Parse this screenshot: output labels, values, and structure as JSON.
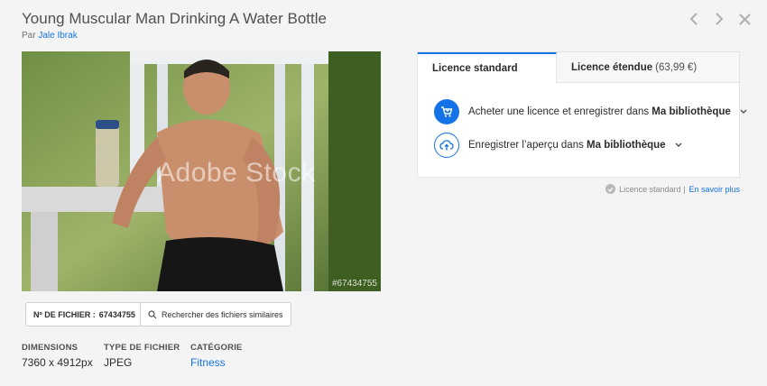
{
  "header": {
    "title": "Young Muscular Man Drinking A Water Bottle",
    "by_prefix": "Par ",
    "author": "Jale Ibrak"
  },
  "nav": {
    "prev_icon": "chevron-left-icon",
    "next_icon": "chevron-right-icon",
    "close_icon": "close-icon"
  },
  "preview": {
    "watermark": "Adobe Stock",
    "image_id": "#67434755"
  },
  "license": {
    "tabs": [
      {
        "label": "Licence standard",
        "price": ""
      },
      {
        "label": "Licence étendue",
        "price": "(63,99 €)"
      }
    ],
    "options": [
      {
        "text": "Acheter une licence et enregistrer dans ",
        "library": "Ma bibliothèque",
        "icon": "cart-icon"
      },
      {
        "text": "Enregistrer l’aperçu dans ",
        "library": "Ma bibliothèque",
        "icon": "cloud-upload-icon"
      }
    ],
    "note_text": "Licence standard | ",
    "note_link": "En savoir plus"
  },
  "actions": {
    "file_label": "Nº DE FICHIER :",
    "file_value": "67434755",
    "similar_label": "Rechercher des fichiers similaires"
  },
  "meta": {
    "dimensions_label": "DIMENSIONS",
    "dimensions_value": "7360 x 4912px",
    "type_label": "TYPE DE FICHIER",
    "type_value": "JPEG",
    "category_label": "CATÉGORIE",
    "category_value": "Fitness"
  },
  "colors": {
    "accent": "#1473e6",
    "background": "#f4f4f4"
  }
}
